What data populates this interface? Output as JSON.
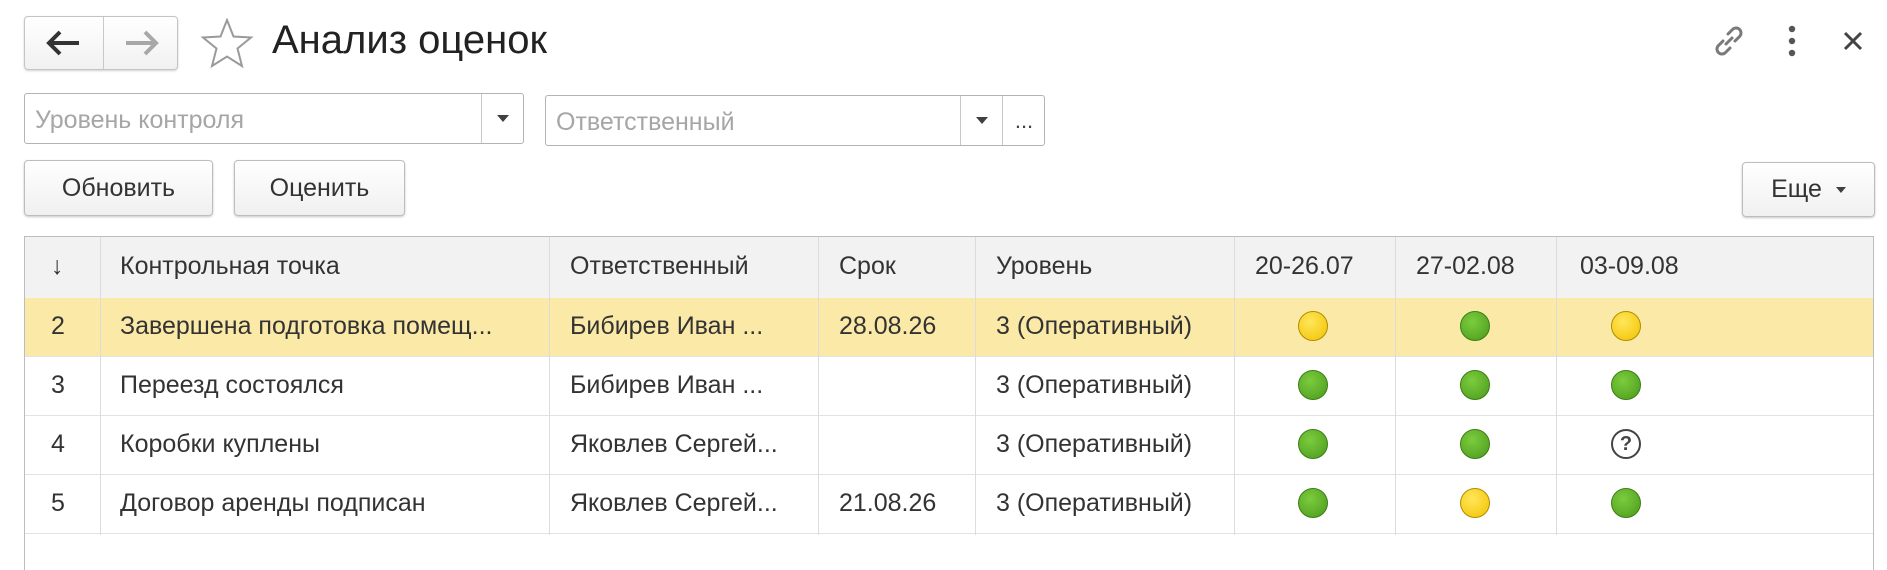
{
  "window": {
    "title": "Анализ оценок"
  },
  "filters": {
    "level_placeholder": "Уровень контроля",
    "responsible_placeholder": "Ответственный",
    "select_button_label": "..."
  },
  "toolbar": {
    "refresh_label": "Обновить",
    "evaluate_label": "Оценить",
    "more_label": "Еще"
  },
  "table": {
    "columns": {
      "sort": "↓",
      "checkpoint": "Контрольная точка",
      "responsible": "Ответственный",
      "deadline": "Срок",
      "level": "Уровень",
      "week1": "20-26.07",
      "week2": "27-02.08",
      "week3": "03-09.08"
    },
    "rows": [
      {
        "num": "2",
        "checkpoint": "Завершена подготовка помещ...",
        "responsible": "Бибирев Иван ...",
        "deadline": "28.08.26",
        "level": "3 (Оперативный)",
        "ratings": [
          "yellow",
          "green",
          "yellow"
        ],
        "selected": true
      },
      {
        "num": "3",
        "checkpoint": "Переезд состоялся",
        "responsible": "Бибирев Иван ...",
        "deadline": "",
        "level": "3 (Оперативный)",
        "ratings": [
          "green",
          "green",
          "green"
        ],
        "selected": false
      },
      {
        "num": "4",
        "checkpoint": "Коробки куплены",
        "responsible": "Яковлев Сергей...",
        "deadline": "",
        "level": "3 (Оперативный)",
        "ratings": [
          "green",
          "green",
          "question"
        ],
        "selected": false
      },
      {
        "num": "5",
        "checkpoint": "Договор аренды подписан",
        "responsible": "Яковлев Сергей...",
        "deadline": "21.08.26",
        "level": "3 (Оперативный)",
        "ratings": [
          "green",
          "yellow",
          "green"
        ],
        "selected": false
      }
    ]
  },
  "icons": {
    "back": "arrow-left-icon",
    "forward": "arrow-right-icon",
    "favorite": "star-icon",
    "link": "link-icon",
    "menu": "more-vertical-icon",
    "close": "close-icon",
    "dropdown": "chevron-down-icon",
    "question": "?"
  },
  "colors": {
    "selected_row": "#fbe9a8",
    "rating_green": "#5aa82a",
    "rating_yellow": "#f7d000"
  }
}
